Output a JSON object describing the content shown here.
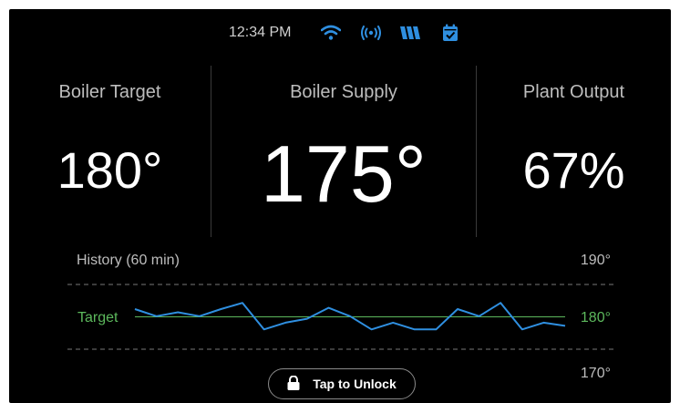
{
  "status_bar": {
    "time": "12:34 PM",
    "icons": [
      "wifi-icon",
      "broadcast-icon",
      "brand-logo-icon",
      "calendar-check-icon"
    ]
  },
  "panels": [
    {
      "label": "Boiler Target",
      "value": "180°"
    },
    {
      "label": "Boiler Supply",
      "value": "175°"
    },
    {
      "label": "Plant Output",
      "value": "67%"
    }
  ],
  "history": {
    "label": "History (60 min)",
    "target_label": "Target",
    "ticks": [
      "190°",
      "180°",
      "170°"
    ]
  },
  "unlock": {
    "label": "Tap to Unlock"
  },
  "colors": {
    "accent": "#2f8fe0",
    "target": "#5cb85c",
    "text": "#ffffff",
    "muted": "#bdbdbd"
  },
  "chart_data": {
    "type": "line",
    "ylim": [
      170,
      190
    ],
    "target": 180,
    "series": [
      {
        "values": [
          182.4,
          180.2,
          181.4,
          180.2,
          182.4,
          184.3,
          176.1,
          178.2,
          179.4,
          182.8,
          180.2,
          176.1,
          178.2,
          176.1,
          176.1,
          182.4,
          180.2,
          184.3,
          176.1,
          178.2,
          177.2
        ]
      }
    ]
  }
}
